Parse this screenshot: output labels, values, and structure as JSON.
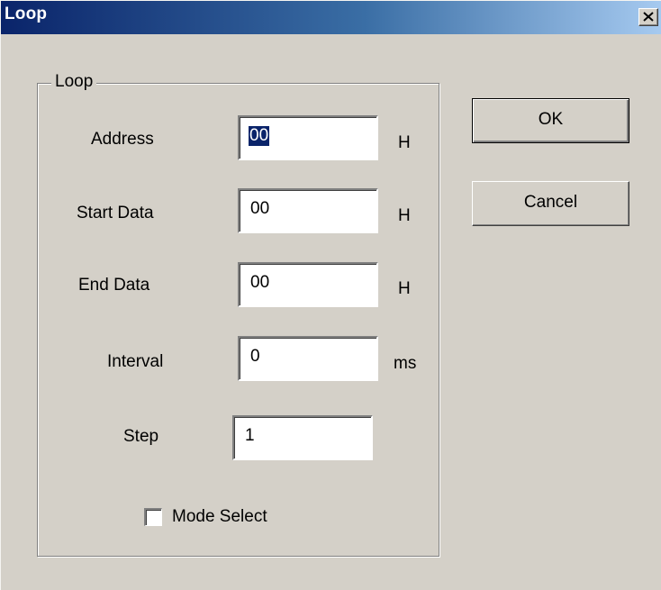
{
  "window": {
    "title": "Loop",
    "close_glyph": "✕"
  },
  "group": {
    "legend": "Loop"
  },
  "fields": {
    "address": {
      "label": "Address",
      "value": "00",
      "unit": "H"
    },
    "start_data": {
      "label": "Start Data",
      "value": "00",
      "unit": "H"
    },
    "end_data": {
      "label": "End Data",
      "value": "00",
      "unit": "H"
    },
    "interval": {
      "label": "Interval",
      "value": "0",
      "unit": "ms"
    },
    "step": {
      "label": "Step",
      "value": "1"
    }
  },
  "mode_select": {
    "label": "Mode Select",
    "checked": false
  },
  "buttons": {
    "ok": "OK",
    "cancel": "Cancel"
  },
  "colors": {
    "face": "#d4d0c8",
    "title_start": "#0a246a",
    "title_end": "#a6caf0",
    "selection": "#0a246a"
  },
  "icons": {
    "close": "close-icon"
  }
}
